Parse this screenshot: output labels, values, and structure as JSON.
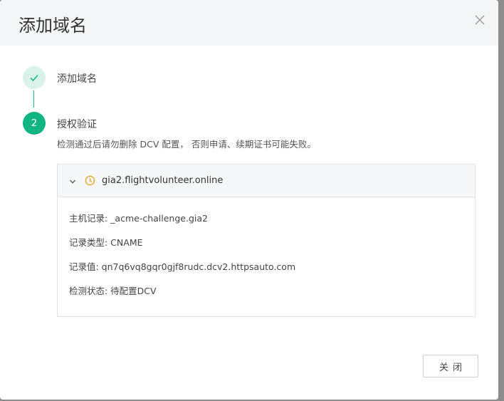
{
  "dialog": {
    "title": "添加域名",
    "close_icon": "close-icon"
  },
  "steps": [
    {
      "label": "添加域名",
      "state": "done",
      "icon": "check-icon"
    },
    {
      "label": "授权验证",
      "number": "2",
      "state": "active",
      "description": "检测通过后请勿删除 DCV 配置， 否则申请、续期证书可能失败。"
    }
  ],
  "panel": {
    "domain": "gia2.flightvolunteer.online",
    "status_icon": "clock-icon",
    "expand_icon": "chevron-down-icon",
    "rows": [
      "主机记录: _acme-challenge.gia2",
      "记录类型: CNAME",
      "记录值: qn7q6vq8gqr0gjf8rudc.dcv2.httpsauto.com",
      "检测状态: 待配置DCV"
    ]
  },
  "footer": {
    "close_label": "关闭"
  },
  "colors": {
    "accent": "#12b581",
    "accent_light": "#d9f3ea",
    "pending": "#f0a020"
  }
}
